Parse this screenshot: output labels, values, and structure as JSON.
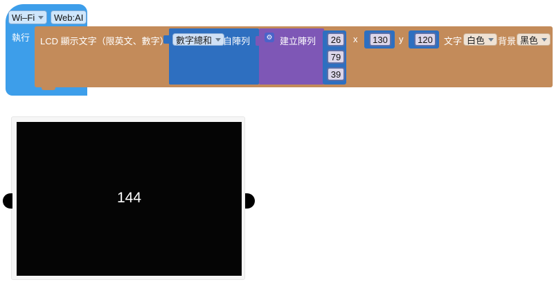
{
  "hat_block": {
    "wifi_dropdown": "Wi–Fi",
    "webai_label": "Web:AI",
    "run_label": "執行"
  },
  "lcd_block": {
    "label": "LCD 顯示文字（限英文、數字）",
    "sum_dropdown": "數字總和",
    "from_array_label": "自陣列",
    "create_array_label": "建立陣列",
    "array_values": [
      "26",
      "79",
      "39"
    ],
    "x_label": "x",
    "x_value": "130",
    "y_label": "y",
    "y_value": "120",
    "text_color_label": "文字",
    "text_color_value": "白色",
    "bg_label": "背景",
    "bg_value": "黑色"
  },
  "lcd_screen": {
    "display_text": "144"
  },
  "colors": {
    "hat": "#3d9eea",
    "lcd_block": "#c38b5a",
    "math_block": "#2e6fc0",
    "list_block": "#7e57b6",
    "screen": "#050505"
  }
}
